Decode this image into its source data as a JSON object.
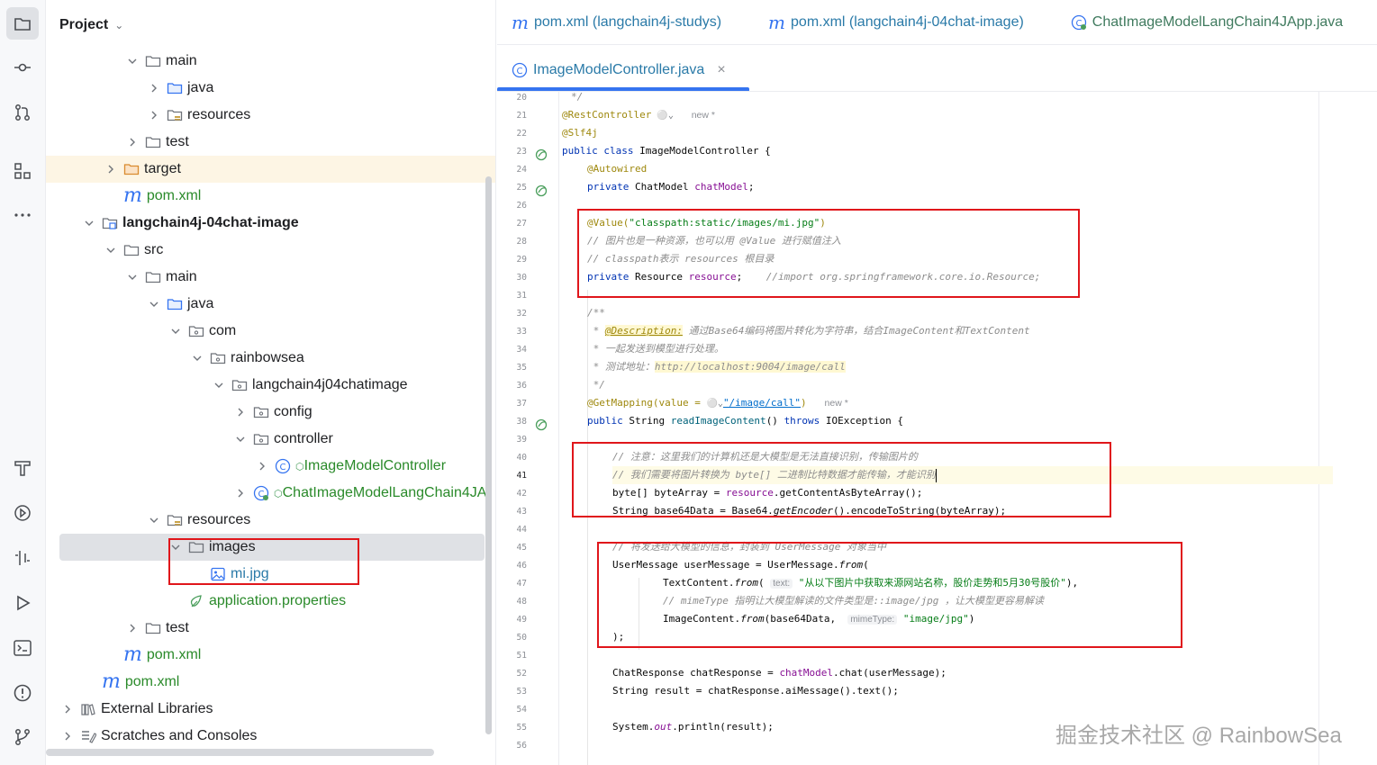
{
  "project_panel": {
    "title": "Project",
    "tree": [
      {
        "label": "main",
        "type": "folder",
        "expanded": true
      },
      {
        "label": "java",
        "type": "src-folder",
        "expanded": false
      },
      {
        "label": "resources",
        "type": "res-folder",
        "expanded": false
      },
      {
        "label": "test",
        "type": "folder",
        "expanded": false
      },
      {
        "label": "target",
        "type": "target-folder",
        "expanded": false
      },
      {
        "label": "pom.xml",
        "type": "maven"
      },
      {
        "label": "langchain4j-04chat-image",
        "type": "module",
        "expanded": true
      },
      {
        "label": "src",
        "type": "folder",
        "expanded": true
      },
      {
        "label": "main",
        "type": "folder",
        "expanded": true
      },
      {
        "label": "java",
        "type": "src-folder",
        "expanded": true
      },
      {
        "label": "com",
        "type": "package",
        "expanded": true
      },
      {
        "label": "rainbowsea",
        "type": "package",
        "expanded": true
      },
      {
        "label": "langchain4j04chatimage",
        "type": "package",
        "expanded": true
      },
      {
        "label": "config",
        "type": "package",
        "expanded": false
      },
      {
        "label": "controller",
        "type": "package",
        "expanded": true
      },
      {
        "label": "ImageModelController",
        "type": "class"
      },
      {
        "label": "ChatImageModelLangChain4JA",
        "type": "app-class"
      },
      {
        "label": "resources",
        "type": "res-folder",
        "expanded": true
      },
      {
        "label": "images",
        "type": "folder",
        "expanded": true
      },
      {
        "label": "mi.jpg",
        "type": "image"
      },
      {
        "label": "application.properties",
        "type": "properties"
      },
      {
        "label": "test",
        "type": "folder",
        "expanded": false
      },
      {
        "label": "pom.xml",
        "type": "maven"
      },
      {
        "label": "pom.xml",
        "type": "maven"
      },
      {
        "label": "External Libraries",
        "type": "libraries",
        "expanded": false
      },
      {
        "label": "Scratches and Consoles",
        "type": "scratches",
        "expanded": false
      }
    ]
  },
  "tabs": {
    "row1": [
      {
        "label": "pom.xml (langchain4j-studys)",
        "icon": "maven"
      },
      {
        "label": "pom.xml (langchain4j-04chat-image)",
        "icon": "maven"
      },
      {
        "label": "ChatImageModelLangChain4JApp.java",
        "icon": "app-class"
      }
    ],
    "active": {
      "label": "ImageModelController.java",
      "icon": "class",
      "close": "×"
    }
  },
  "code": {
    "line_numbers": [
      "20",
      "21",
      "22",
      "23",
      "24",
      "25",
      "26",
      "27",
      "28",
      "29",
      "30",
      "31",
      "32",
      "33",
      "34",
      "35",
      "36",
      "37",
      "38",
      "39",
      "40",
      "41",
      "42",
      "43",
      "44",
      "45",
      "46",
      "47",
      "48",
      "49",
      "50",
      "51",
      "52",
      "53",
      "54",
      "55",
      "56"
    ],
    "l20": "*/",
    "l21_ann": "@RestController",
    "l21_new": "new *",
    "l22": "@Slf4j",
    "l23_a": "public class ",
    "l23_b": "ImageModelController {",
    "l24": "@Autowired",
    "l25_a": "private ",
    "l25_b": "ChatModel ",
    "l25_c": "chatModel",
    "l25_d": ";",
    "l27_a": "@Value(",
    "l27_b": "\"classpath:static/images/mi.jpg\"",
    "l27_c": ")",
    "l28": "// 图片也是一种资源，也可以用 @Value 进行赋值注入",
    "l29": "// classpath表示 resources 根目录",
    "l30_a": "private ",
    "l30_b": "Resource ",
    "l30_c": "resource",
    "l30_d": ";    ",
    "l30_e": "//import org.springframework.core.io.Resource;",
    "l32": "/**",
    "l33_a": " * ",
    "l33_b": "@Description:",
    "l33_c": " 通过Base64编码将图片转化为字符串，结合ImageContent和TextContent",
    "l34": " * 一起发送到模型进行处理。",
    "l35_a": " * 测试地址：",
    "l35_b": "http://localhost:9004/image/call",
    "l36": " */",
    "l37_a": "@GetMapping(value = ",
    "l37_b": "\"/image/call\"",
    "l37_c": ")",
    "l37_new": "new *",
    "l38_a": "public ",
    "l38_b": "String ",
    "l38_c": "readImageContent",
    "l38_d": "() ",
    "l38_e": "throws ",
    "l38_f": "IOException {",
    "l40": "// 注意：这里我们的计算机还是大模型是无法直接识别，传输图片的",
    "l41": "// 我们需要将图片转换为 byte[] 二进制比特数据才能传输，才能识别",
    "l42_a": "byte[] byteArray = ",
    "l42_b": "resource",
    "l42_c": ".getContentAsByteArray();",
    "l43_a": "String base64Data = Base64.",
    "l43_b": "getEncoder",
    "l43_c": "().encodeToString(byteArray);",
    "l45": "// 将发送给大模型的信息，封装到 UserMessage 对象当中",
    "l46_a": "UserMessage userMessage = UserMessage.",
    "l46_b": "from",
    "l46_c": "(",
    "l47_a": "TextContent.",
    "l47_b": "from",
    "l47_c": "( ",
    "l47_hint": "text:",
    "l47_d": "\"从以下图片中获取来源网站名称，股价走势和5月30号股价\"",
    "l47_e": "),",
    "l48": "// mimeType 指明让大模型解读的文件类型是::image/jpg ，让大模型更容易解读",
    "l49_a": "ImageContent.",
    "l49_b": "from",
    "l49_c": "(base64Data,  ",
    "l49_hint": "mimeType:",
    "l49_d": "\"image/jpg\"",
    "l49_e": ")",
    "l50": ");",
    "l52_a": "ChatResponse chatResponse = ",
    "l52_b": "chatModel",
    "l52_c": ".chat(userMessage);",
    "l53": "String result = chatResponse.aiMessage().text();",
    "l55_a": "System.",
    "l55_b": "out",
    "l55_c": ".println(result);"
  },
  "watermark": "掘金技术社区 @ RainbowSea",
  "colors": {
    "keyword": "#0033b3",
    "annotation": "#9e880d",
    "comment": "#8c8c8c",
    "string": "#067d17",
    "field": "#871094",
    "highlight_box": "#e0161b",
    "accent": "#3574f0"
  }
}
